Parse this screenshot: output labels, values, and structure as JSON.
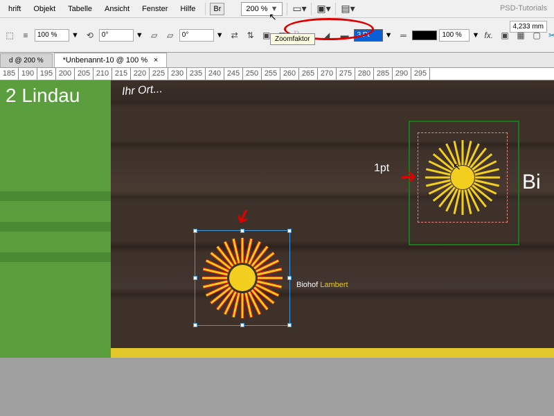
{
  "menubar": {
    "items": [
      "hrift",
      "Objekt",
      "Tabelle",
      "Ansicht",
      "Fenster",
      "Hilfe"
    ],
    "br_btn": "Br",
    "zoom": "200 %",
    "psd": "PSD-Tutorials"
  },
  "toolbar": {
    "opacity": "100 %",
    "angle1": "0°",
    "angle2": "0°",
    "stroke_val": "3 Pt",
    "stroke_pct": "100 %",
    "p": "P",
    "fx": "fx.",
    "right_measure": "4,233 mm"
  },
  "tooltip": "Zoomfaktor",
  "tabs": [
    "d @ 200 %",
    "*Unbenannt-10 @ 100 %"
  ],
  "ruler_start": 185,
  "ruler_step": 5,
  "ruler_count": 23,
  "canvas": {
    "lindau": "2 Lindau",
    "ihrort": "Ihr Ort...",
    "biohof_a": "Biohof ",
    "biohof_b": "Lambert",
    "bi": "Bi"
  },
  "annot": {
    "pt": "1pt"
  }
}
